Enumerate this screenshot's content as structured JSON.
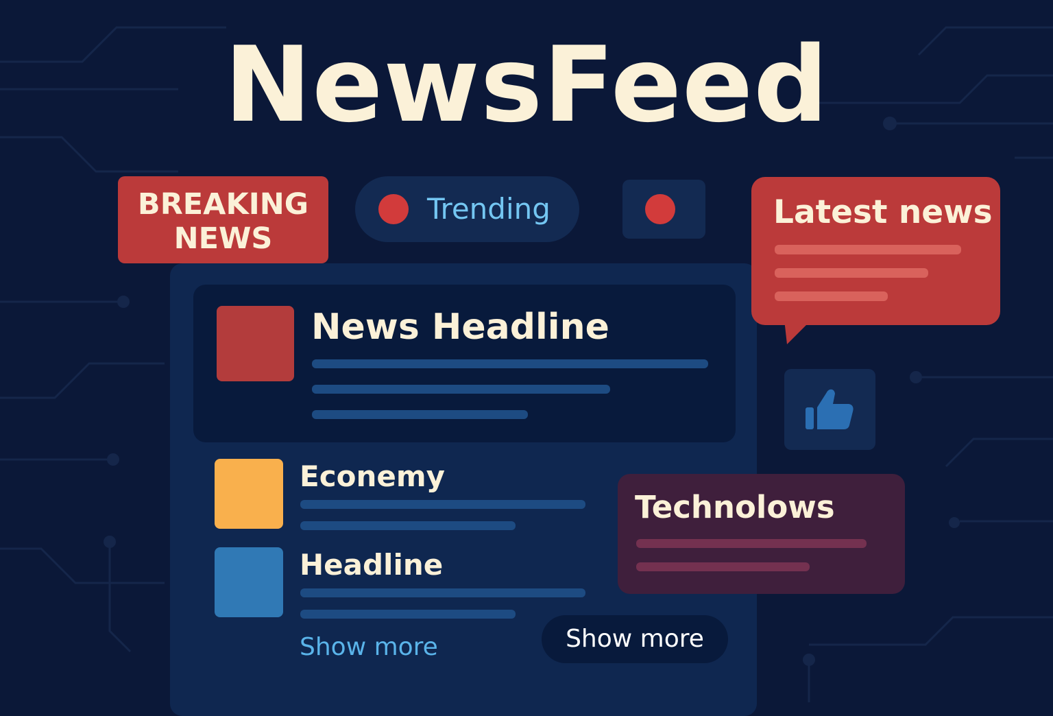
{
  "app": {
    "title": "NewsFeed"
  },
  "badges": {
    "breaking_line1": "BREAKING",
    "breaking_line2": "NEWS",
    "trending": "Trending"
  },
  "feed": {
    "featured": {
      "title": "News Headline"
    },
    "items": [
      {
        "title": "Econemy"
      },
      {
        "title": "Headline"
      }
    ],
    "show_more_link": "Show more",
    "show_more_button": "Show more"
  },
  "latest": {
    "title": "Latest news"
  },
  "tech": {
    "title": "Technolows"
  },
  "icons": {
    "live": "record-dot-icon",
    "like": "thumbs-up-icon"
  },
  "colors": {
    "background": "#0b1838",
    "accent_red": "#bb3a3a",
    "title_cream": "#fbf1d8",
    "link_blue": "#5ab4ea",
    "economy_orange": "#f9b04d",
    "headline_blue": "#3079b5",
    "tech_purple": "#3f1f3c"
  }
}
